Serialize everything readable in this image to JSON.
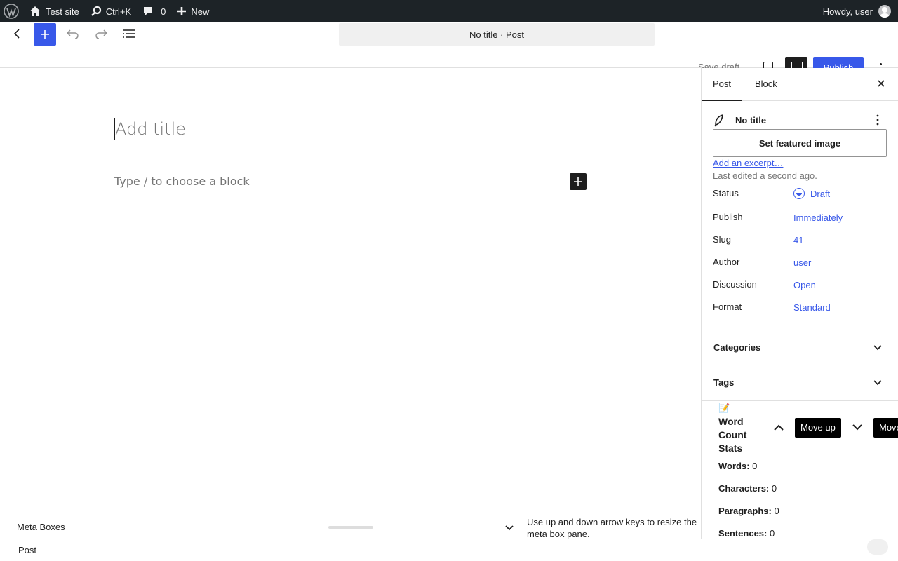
{
  "admin_bar": {
    "site_name": "Test site",
    "search_shortcut": "Ctrl+K",
    "comments_count": "0",
    "new_label": "New",
    "greeting": "Howdy, user"
  },
  "header": {
    "document_title": "No title · Post",
    "save_draft_label": "Save draft",
    "publish_label": "Publish",
    "accent_color": "#3858e9"
  },
  "canvas": {
    "title_placeholder": "Add title",
    "block_placeholder": "Type / to choose a block"
  },
  "metabox_pane": {
    "title": "Meta Boxes",
    "resize_hint": "Use up and down arrow keys to resize the meta box pane."
  },
  "footer": {
    "breadcrumb": "Post"
  },
  "sidebar": {
    "tabs": [
      {
        "label": "Post",
        "active": true
      },
      {
        "label": "Block",
        "active": false
      }
    ],
    "post_title": "No title",
    "featured_image_label": "Set featured image",
    "excerpt_link": "Add an excerpt…",
    "last_edited": "Last edited a second ago.",
    "rows": [
      {
        "label": "Status",
        "value": "Draft"
      },
      {
        "label": "Publish",
        "value": "Immediately"
      },
      {
        "label": "Slug",
        "value": "41"
      },
      {
        "label": "Author",
        "value": "user"
      },
      {
        "label": "Discussion",
        "value": "Open"
      },
      {
        "label": "Format",
        "value": "Standard"
      }
    ],
    "panels": [
      {
        "title": "Categories"
      },
      {
        "title": "Tags"
      }
    ],
    "word_count": {
      "emoji": "📝",
      "title": "Word Count Stats",
      "move_up_tooltip": "Move up",
      "move_down_tooltip": "Move",
      "stats": [
        {
          "label": "Words:",
          "value": "0"
        },
        {
          "label": "Characters:",
          "value": "0"
        },
        {
          "label": "Paragraphs:",
          "value": "0"
        },
        {
          "label": "Sentences:",
          "value": "0"
        }
      ]
    }
  }
}
